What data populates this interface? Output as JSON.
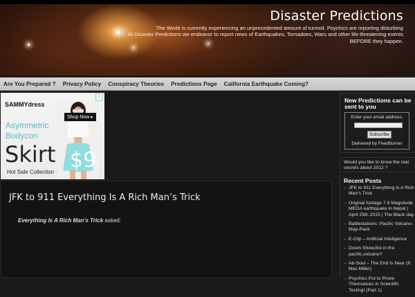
{
  "site": {
    "title": "Disaster Predictions",
    "tagline_1": "The World is currently experiencing an unprecedented amount of turmoil. Psychics are reporting disturbing",
    "tagline_2": "At Disaster Predictions we endeavor to report news of Earthquakes, Tornadoes, Wars and other life-threatening events",
    "tagline_3": "BEFORE they happen."
  },
  "nav": {
    "items": [
      {
        "label": "Are You Prepared ?"
      },
      {
        "label": "Privacy Policy"
      },
      {
        "label": "Conspiracy Theories"
      },
      {
        "label": "Predictions Page"
      },
      {
        "label": "California Earthquake Coming?"
      }
    ]
  },
  "ad": {
    "brand": "SAMMYdress",
    "line1": "Asymmetric",
    "line2": "Bodycon",
    "line3": "Skirt",
    "shop_label": "Shop Now ▸",
    "price": "$9",
    "footer": "Hot Sale Collection"
  },
  "post": {
    "title": "JFK to 911 Everything Is A Rich Man’s Trick",
    "author": "Everything Is A Rich Man’s Trick",
    "meta_suffix": "asked:"
  },
  "sidebar": {
    "subscribe_title": "New Predictions can be sent to you",
    "email_label": "Enter your email address:",
    "email_value": "",
    "subscribe_button": "Subscribe",
    "delivered_by": "Delivered by FeedBurner",
    "secret_text": "Would you like to know the real secrets about 2012 ?",
    "recent_title": "Recent Posts",
    "recent_posts": [
      "JFK to 911 Everything Is A Rich Man’s Trick",
      "Original footage 7.9 Magnitude MEGA earthquake in Nepal | April 25th 2015 | The Black day",
      "Battlestations: Pacific Volcano-Map-Pack",
      "E-Clip – Artificial Inteligence",
      "Doom Show,fire in the pacific,volcano?",
      "Ab-Soul – The End Is Near (ft. Mac Miller)",
      "Psychics Put to Prove Themselves in Scientific Testing! (Part 1)"
    ]
  }
}
